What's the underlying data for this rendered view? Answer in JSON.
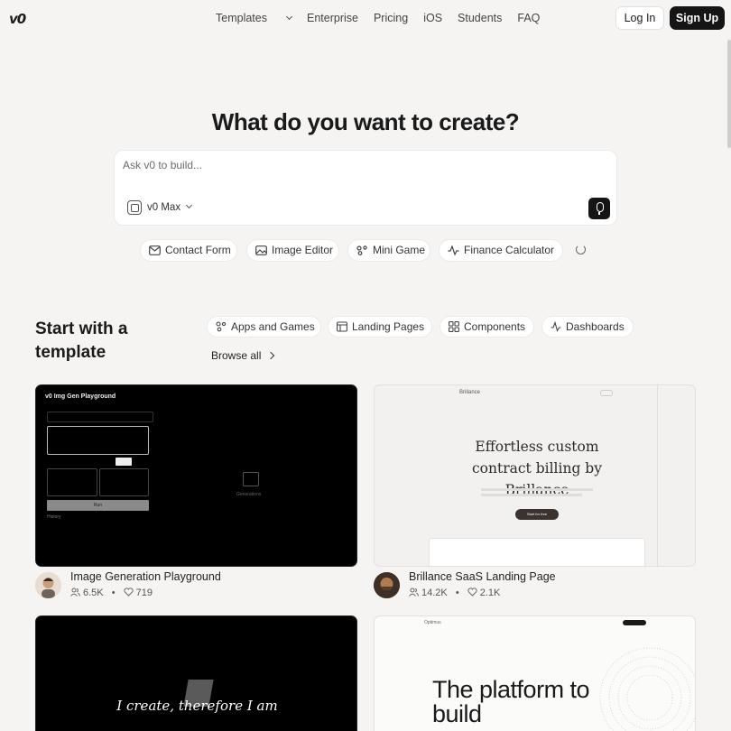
{
  "header": {
    "logo": "v0",
    "nav": [
      "Templates",
      "Enterprise",
      "Pricing",
      "iOS",
      "Students",
      "FAQ"
    ],
    "login_label": "Log In",
    "signup_label": "Sign Up"
  },
  "hero": {
    "title": "What do you want to create?",
    "prompt_placeholder": "Ask v0 to build...",
    "model_label": "v0 Max"
  },
  "suggestions": [
    "Contact Form",
    "Image Editor",
    "Mini Game",
    "Finance Calculator"
  ],
  "templates_section": {
    "title": "Start with a template",
    "categories": [
      "Apps and Games",
      "Landing Pages",
      "Components",
      "Dashboards"
    ],
    "browse_all": "Browse all"
  },
  "cards": [
    {
      "title": "Image Generation Playground",
      "users": "6.5K",
      "likes": "719",
      "preview": {
        "heading": "v0 Img Gen Playground",
        "button": "Run",
        "label_history": "History",
        "label_generations": "Generations"
      }
    },
    {
      "title": "Brillance SaaS Landing Page",
      "users": "14.2K",
      "likes": "2.1K",
      "preview": {
        "brand": "Brillance",
        "headline": "Effortless custom contract billing by Brillance",
        "cta": "Start for free"
      }
    },
    {
      "title": "",
      "preview": {
        "text": "I create, therefore I am"
      }
    },
    {
      "title": "",
      "preview": {
        "brand": "Optimus",
        "headline": "The platform to build"
      }
    }
  ],
  "colors": {
    "accent_dark": "#151515",
    "page_bg": "#f5f4f3",
    "card_dark": "#000000"
  },
  "icons": [
    "mail-icon",
    "image-icon",
    "game-icon",
    "chart-line-icon",
    "refresh-icon",
    "mic-icon",
    "users-icon",
    "heart-icon"
  ]
}
